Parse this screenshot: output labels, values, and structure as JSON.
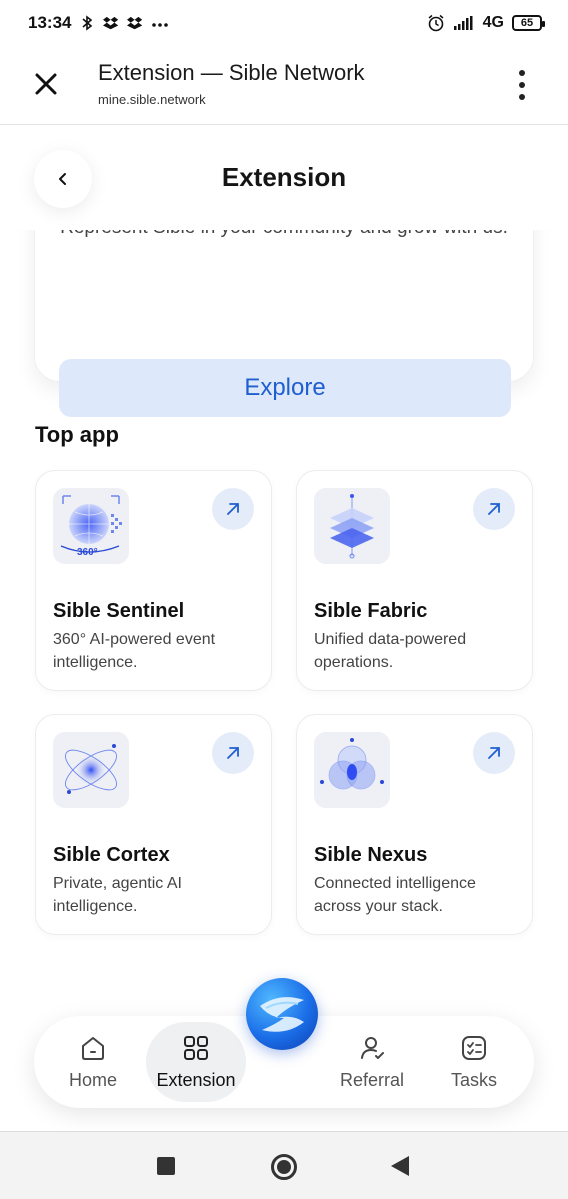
{
  "status_bar": {
    "time": "13:34",
    "left_icons": [
      "bluetooth-icon",
      "dropbox-icon",
      "dropbox-icon",
      "more-dots-icon"
    ],
    "network": "4G",
    "battery": "65"
  },
  "browser": {
    "title": "Extension — Sible Network",
    "url": "mine.sible.network"
  },
  "page": {
    "title": "Extension",
    "promo_text": "Represent Sible in your community and grow with us.",
    "explore_label": "Explore",
    "section_title": "Top app"
  },
  "apps": [
    {
      "name": "Sible Sentinel",
      "desc": "360° AI-powered event intelligence.",
      "icon": "globe-360-icon",
      "badge": "360°"
    },
    {
      "name": "Sible Fabric",
      "desc": "Unified data-powered operations.",
      "icon": "layers-icon"
    },
    {
      "name": "Sible Cortex",
      "desc": "Private, agentic AI intelligence.",
      "icon": "orbit-icon"
    },
    {
      "name": "Sible Nexus",
      "desc": "Connected intelligence across your stack.",
      "icon": "venn-icon"
    }
  ],
  "nav": {
    "items": [
      {
        "label": "Home",
        "icon": "home-icon"
      },
      {
        "label": "Extension",
        "icon": "grid-icon",
        "active": true
      },
      {
        "label": "Referral",
        "icon": "user-add-icon"
      },
      {
        "label": "Tasks",
        "icon": "checklist-icon"
      }
    ]
  },
  "colors": {
    "accent": "#1f5fd0",
    "explore_bg": "#dde9fb",
    "arrow_bg": "#e4ecfa"
  }
}
